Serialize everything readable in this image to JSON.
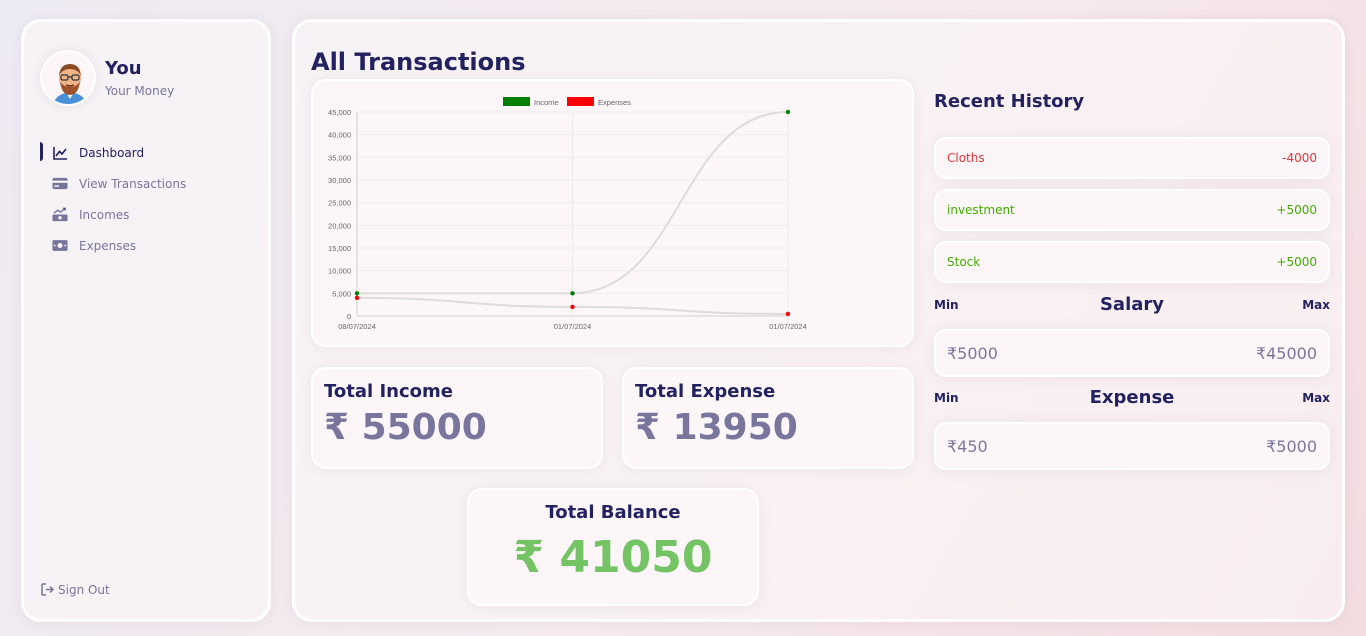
{
  "user": {
    "name": "You",
    "subtitle": "Your Money"
  },
  "menu": [
    {
      "label": "Dashboard",
      "icon": "line-chart-icon",
      "active": true
    },
    {
      "label": "View Transactions",
      "icon": "credit-card-icon",
      "active": false
    },
    {
      "label": "Incomes",
      "icon": "money-bill-trend-icon",
      "active": false
    },
    {
      "label": "Expenses",
      "icon": "money-bill-icon",
      "active": false
    }
  ],
  "signout": {
    "label": "Sign Out",
    "icon": "sign-out-icon"
  },
  "page": {
    "title": "All Transactions"
  },
  "chart_data": {
    "type": "line",
    "categories": [
      "08/07/2024",
      "01/07/2024",
      "01/07/2024"
    ],
    "series": [
      {
        "name": "Income",
        "color": "#008000",
        "values": [
          5000,
          5000,
          45000
        ]
      },
      {
        "name": "Expenses",
        "color": "#ff0000",
        "values": [
          4000,
          2000,
          450
        ]
      }
    ],
    "yticks": [
      "0",
      "5,000",
      "10,000",
      "15,000",
      "20,000",
      "25,000",
      "30,000",
      "35,000",
      "40,000",
      "45,000"
    ],
    "ylim": [
      0,
      45000
    ],
    "grid": true,
    "legend_position": "top"
  },
  "totals": {
    "income_label": "Total Income",
    "income_value": "₹ 55000",
    "expense_label": "Total Expense",
    "expense_value": "₹ 13950",
    "balance_label": "Total Balance",
    "balance_value": "₹ 41050"
  },
  "history": {
    "title": "Recent History",
    "items": [
      {
        "title": "Cloths",
        "amount": "-4000",
        "type": "expense"
      },
      {
        "title": "investment",
        "amount": "+5000",
        "type": "income"
      },
      {
        "title": "Stock",
        "amount": "+5000",
        "type": "income"
      }
    ]
  },
  "salary_range": {
    "title": "Salary",
    "min_label": "Min",
    "max_label": "Max",
    "min": "₹5000",
    "max": "₹45000"
  },
  "expense_range": {
    "title": "Expense",
    "min_label": "Min",
    "max_label": "Max",
    "min": "₹450",
    "max": "₹5000"
  },
  "colors": {
    "primary": "#222260",
    "income": "#42ad00",
    "expense": "#e0393b",
    "balance": "#74c365"
  }
}
